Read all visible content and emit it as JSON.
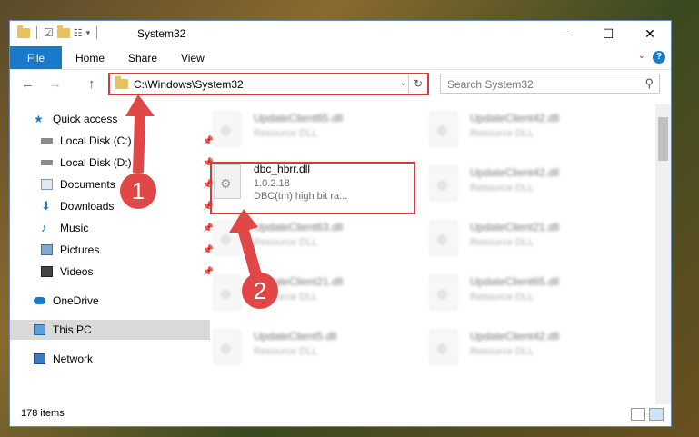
{
  "window": {
    "title": "System32",
    "controls": {
      "minimize": "—",
      "maximize": "☐",
      "close": "✕"
    }
  },
  "ribbon": {
    "file": "File",
    "home": "Home",
    "share": "Share",
    "view": "View",
    "help": "?"
  },
  "nav": {
    "back": "←",
    "forward": "→",
    "up": "↑",
    "address": "C:\\Windows\\System32",
    "refresh": "↻",
    "search_placeholder": "Search System32"
  },
  "sidebar": {
    "items": [
      {
        "label": "Quick access",
        "icon": "star-icon"
      },
      {
        "label": "Local Disk (C:)",
        "icon": "drive-icon"
      },
      {
        "label": "Local Disk (D:)",
        "icon": "drive-icon"
      },
      {
        "label": "Documents",
        "icon": "documents-icon"
      },
      {
        "label": "Downloads",
        "icon": "download-icon"
      },
      {
        "label": "Music",
        "icon": "music-icon"
      },
      {
        "label": "Pictures",
        "icon": "pictures-icon"
      },
      {
        "label": "Videos",
        "icon": "videos-icon"
      },
      {
        "label": "OneDrive",
        "icon": "cloud-icon"
      },
      {
        "label": "This PC",
        "icon": "pc-icon"
      },
      {
        "label": "Network",
        "icon": "network-icon"
      }
    ]
  },
  "files": {
    "selected": {
      "name": "dbc_hbrr.dll",
      "version": "1.0.2.18",
      "description": "DBC(tm) high bit ra..."
    },
    "blurred": [
      {
        "name": "UpdateClient65.dll",
        "type": "Resource DLL"
      },
      {
        "name": "UpdateClient42.dll",
        "type": "Resource DLL"
      },
      {
        "name": "UpdateClient42.dll",
        "type": "Resource DLL"
      },
      {
        "name": "UpdateClient63.dll",
        "type": "Resource DLL"
      },
      {
        "name": "UpdateClient21.dll",
        "type": "Resource DLL"
      },
      {
        "name": "UpdateClient21.dll",
        "type": "Resource DLL"
      },
      {
        "name": "UpdateClient65.dll",
        "type": "Resource DLL"
      },
      {
        "name": "UpdateClient5.dll",
        "type": "Resource DLL"
      },
      {
        "name": "UpdateClient42.dll",
        "type": "Resource DLL"
      }
    ]
  },
  "status": {
    "item_count": "178 items"
  },
  "markers": {
    "one": "1",
    "two": "2"
  },
  "colors": {
    "accent": "#1979ca",
    "highlight": "#d23b3b"
  }
}
